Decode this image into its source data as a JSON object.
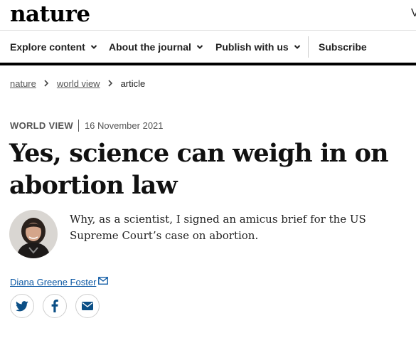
{
  "masthead": {
    "logo_text": "nature",
    "cut_text": "V"
  },
  "nav": {
    "items": [
      {
        "label": "Explore content",
        "has_dropdown": true
      },
      {
        "label": "About the journal",
        "has_dropdown": true
      },
      {
        "label": "Publish with us",
        "has_dropdown": true
      },
      {
        "label": "Subscribe",
        "has_dropdown": false
      }
    ]
  },
  "breadcrumb": {
    "items": [
      "nature",
      "world view",
      "article"
    ]
  },
  "article": {
    "type": "WORLD VIEW",
    "date": "16 November 2021",
    "title": "Yes, science can weigh in on abortion law",
    "standfirst": "Why, as a scientist, I signed an amicus brief for the US Supreme Court’s case on abortion.",
    "author": "Diana Greene Foster"
  },
  "share": {
    "icons": [
      "twitter-icon",
      "facebook-icon",
      "email-icon"
    ]
  },
  "colors": {
    "accent_link": "#0a57a3",
    "text": "#222222",
    "nav_bar": "#000000",
    "share_icon": "#0b4f86"
  }
}
